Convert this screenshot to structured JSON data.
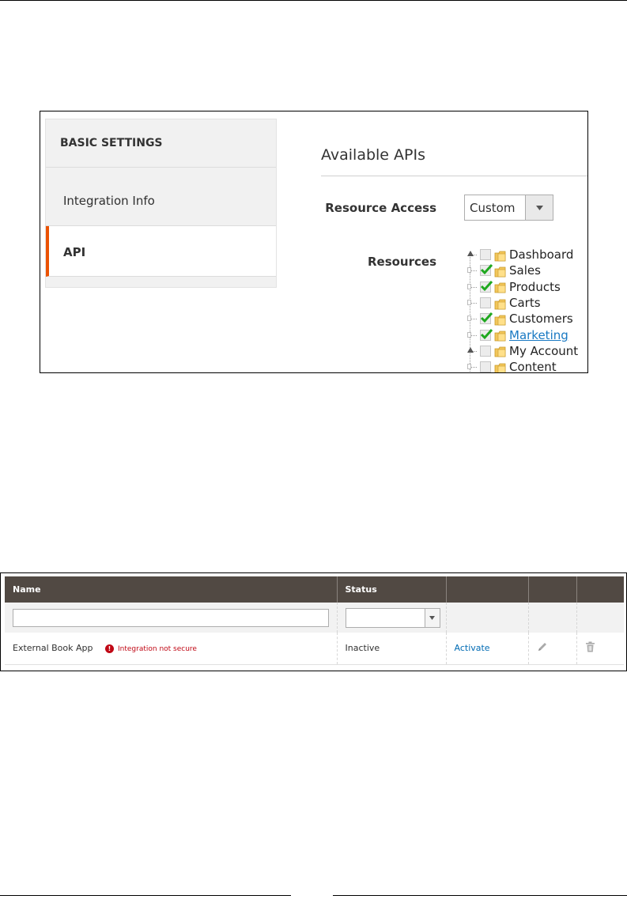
{
  "integration_edit": {
    "sidebar": {
      "heading": "BASIC SETTINGS",
      "items": [
        {
          "label": "Integration Info",
          "active": false
        },
        {
          "label": "API",
          "active": true
        }
      ],
      "active_accent": "#eb5202"
    },
    "available_apis": {
      "title": "Available APIs",
      "resource_access": {
        "label": "Resource Access",
        "value": "Custom"
      },
      "resources": {
        "label": "Resources",
        "tree": [
          {
            "label": "Dashboard",
            "checked": false,
            "expanded": true,
            "link": false
          },
          {
            "label": "Sales",
            "checked": true,
            "expanded": false,
            "link": false
          },
          {
            "label": "Products",
            "checked": true,
            "expanded": false,
            "link": false
          },
          {
            "label": "Carts",
            "checked": false,
            "expanded": false,
            "link": false
          },
          {
            "label": "Customers",
            "checked": true,
            "expanded": false,
            "link": false
          },
          {
            "label": "Marketing",
            "checked": true,
            "expanded": false,
            "link": true
          },
          {
            "label": "My Account",
            "checked": false,
            "expanded": true,
            "link": false
          },
          {
            "label": "Content",
            "checked": false,
            "expanded": false,
            "link": false
          }
        ]
      }
    }
  },
  "integrations_grid": {
    "columns": [
      "Name",
      "Status",
      "",
      "",
      ""
    ],
    "filters": {
      "name_value": "",
      "status_value": ""
    },
    "rows": [
      {
        "name": "External Book App",
        "warning": "Integration not secure",
        "status": "Inactive",
        "action": "Activate",
        "edit_icon": "pencil-icon",
        "delete_icon": "trash-icon"
      }
    ],
    "header_color": "#514943",
    "warning_color": "#c00815",
    "link_color": "#006bb4"
  }
}
